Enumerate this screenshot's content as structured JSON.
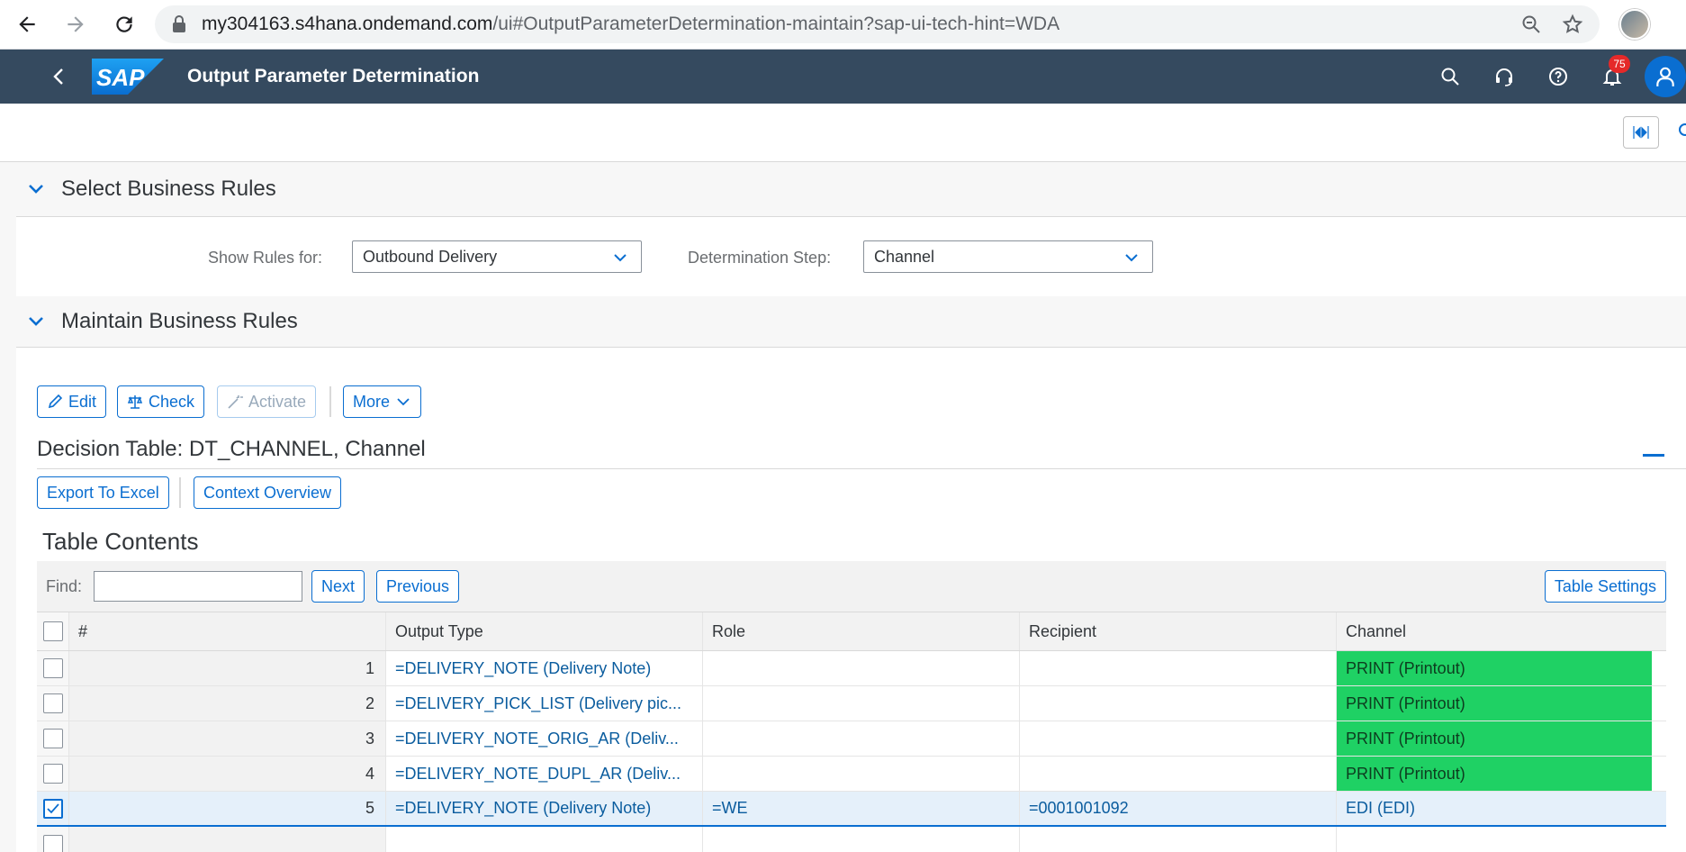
{
  "browser": {
    "url_host": "my304163.s4hana.ondemand.com",
    "url_path": "/ui#OutputParameterDetermination-maintain?sap-ui-tech-hint=WDA"
  },
  "shell": {
    "logo_text": "SAP",
    "title": "Output Parameter Determination",
    "notification_count": "75"
  },
  "select_section": {
    "title": "Select Business Rules",
    "show_rules_label": "Show Rules for:",
    "show_rules_value": "Outbound Delivery",
    "step_label": "Determination Step:",
    "step_value": "Channel"
  },
  "maintain_section": {
    "title": "Maintain Business Rules",
    "toolbar": {
      "edit": "Edit",
      "check": "Check",
      "activate": "Activate",
      "more": "More"
    },
    "decision_table_title": "Decision Table: DT_CHANNEL, Channel",
    "export_label": "Export To Excel",
    "context_label": "Context Overview",
    "table_contents_title": "Table Contents",
    "find_label": "Find:",
    "find_value": "",
    "next_label": "Next",
    "previous_label": "Previous",
    "table_settings_label": "Table Settings",
    "columns": [
      "#",
      "Output Type",
      "Role",
      "Recipient",
      "Channel"
    ],
    "rows": [
      {
        "num": "1",
        "output_type": "=DELIVERY_NOTE (Delivery Note)",
        "role": "",
        "recipient": "",
        "channel": "PRINT (Printout)",
        "checked": false,
        "highlight": true
      },
      {
        "num": "2",
        "output_type": "=DELIVERY_PICK_LIST (Delivery pic...",
        "role": "",
        "recipient": "",
        "channel": "PRINT (Printout)",
        "checked": false,
        "highlight": true
      },
      {
        "num": "3",
        "output_type": "=DELIVERY_NOTE_ORIG_AR (Deliv...",
        "role": "",
        "recipient": "",
        "channel": "PRINT (Printout)",
        "checked": false,
        "highlight": true
      },
      {
        "num": "4",
        "output_type": "=DELIVERY_NOTE_DUPL_AR (Deliv...",
        "role": "",
        "recipient": "",
        "channel": "PRINT (Printout)",
        "checked": false,
        "highlight": true
      },
      {
        "num": "5",
        "output_type": "=DELIVERY_NOTE (Delivery Note)",
        "role": "=WE",
        "recipient": "=0001001092",
        "channel": "EDI (EDI)",
        "checked": true,
        "highlight": false
      }
    ]
  },
  "colors": {
    "shell_bg": "#354a5f",
    "accent": "#0a6ed1",
    "channel_highlight": "#1fd164",
    "badge": "#e52929"
  }
}
